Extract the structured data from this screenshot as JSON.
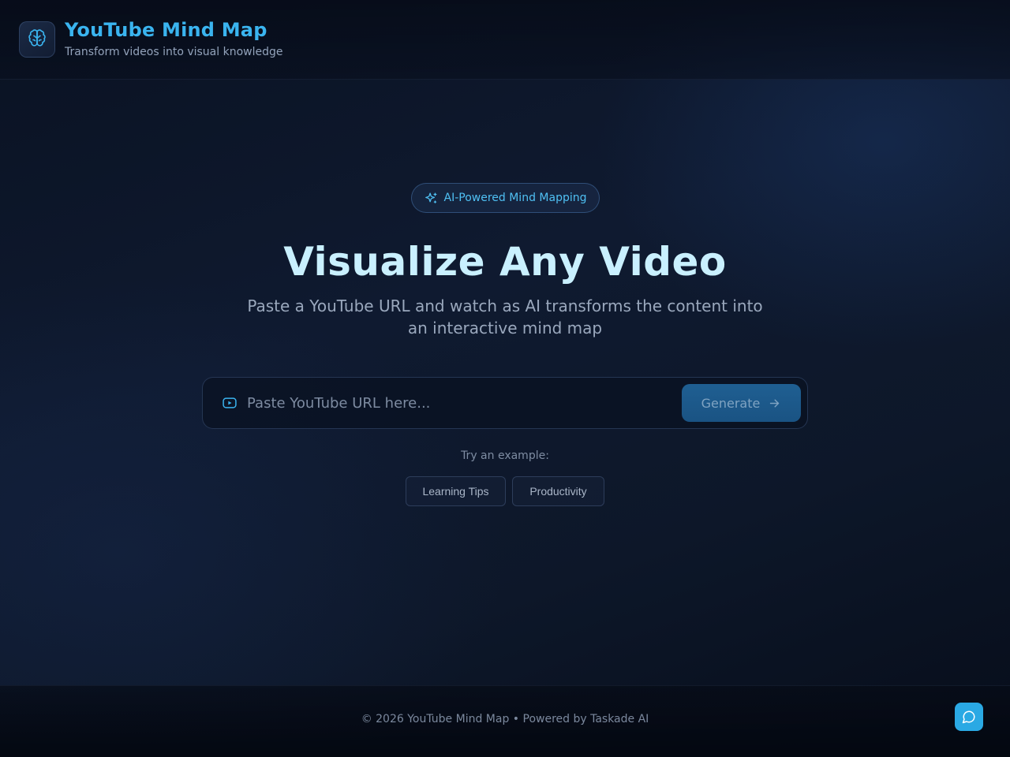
{
  "header": {
    "title": "YouTube Mind Map",
    "subtitle": "Transform videos into visual knowledge",
    "logo_icon": "brain-icon"
  },
  "hero": {
    "badge_icon": "sparkles-icon",
    "badge_text": "AI-Powered Mind Mapping",
    "title": "Visualize Any Video",
    "description": "Paste a YouTube URL and watch as AI transforms the content into an interactive mind map"
  },
  "url_form": {
    "icon": "youtube-icon",
    "value": "",
    "placeholder": "Paste YouTube URL here...",
    "button_label": "Generate",
    "button_icon": "arrow-right-icon"
  },
  "examples": {
    "label": "Try an example:",
    "items": [
      {
        "label": "Learning Tips"
      },
      {
        "label": "Productivity"
      }
    ]
  },
  "footer": {
    "text": "© 2026 YouTube Mind Map • Powered by Taskade AI",
    "chat_icon": "chat-bubble-icon"
  },
  "colors": {
    "accent": "#3ab4ef",
    "hero_title": "#c9f0ff",
    "generate_button": "#1f5f92",
    "chat_button": "#2aa9e4",
    "background": "#0b1325"
  }
}
